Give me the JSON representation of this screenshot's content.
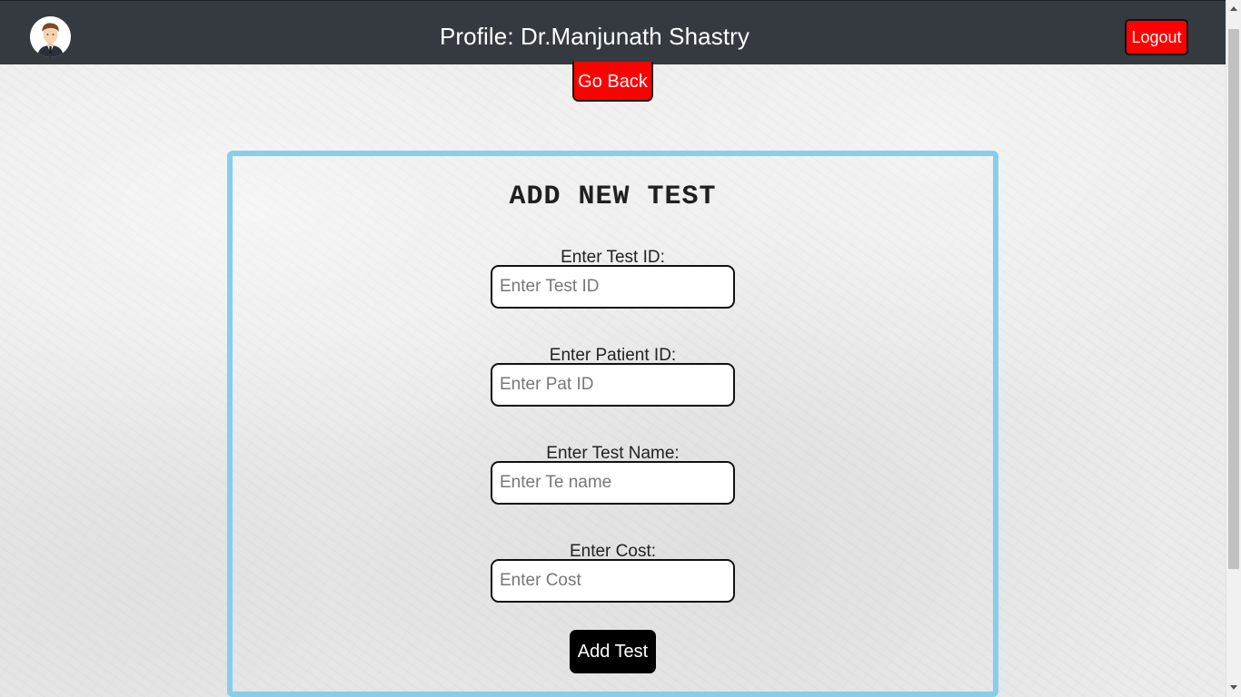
{
  "header": {
    "title": "Profile: Dr.Manjunath Shastry",
    "logout_label": "Logout",
    "avatar_icon": "doctor-avatar-icon"
  },
  "go_back_label": "Go Back",
  "form": {
    "title": "ADD NEW TEST",
    "fields": [
      {
        "label": "Enter Test ID:",
        "placeholder": "Enter Test ID",
        "value": ""
      },
      {
        "label": "Enter Patient ID:",
        "placeholder": "Enter Pat ID",
        "value": ""
      },
      {
        "label": "Enter Test Name:",
        "placeholder": "Enter Te name",
        "value": ""
      },
      {
        "label": "Enter Cost:",
        "placeholder": "Enter Cost",
        "value": ""
      }
    ],
    "submit_label": "Add Test"
  },
  "colors": {
    "header_bg": "#343a40",
    "danger_button": "#ff0000",
    "card_border": "#87ceeb",
    "submit_button": "#000000"
  }
}
